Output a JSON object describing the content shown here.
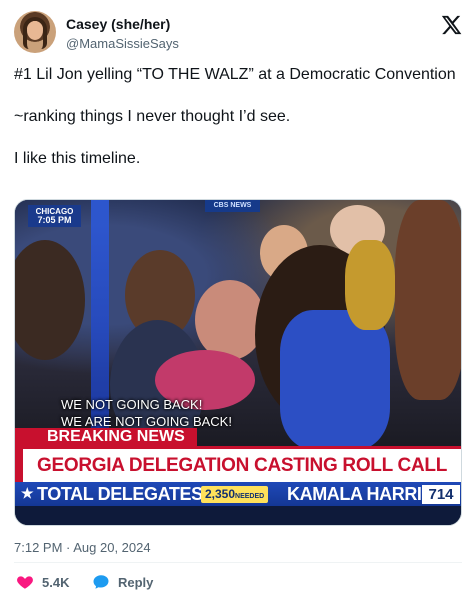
{
  "author": {
    "name": "Casey (she/her)",
    "handle": "@MamaSissieSays"
  },
  "icons": {
    "logo": "x-logo-icon",
    "like": "heart-icon",
    "reply": "speech-bubble-icon"
  },
  "tweet": {
    "paragraphs": [
      "#1 Lil Jon yelling “TO THE WALZ” at a Democratic Convention",
      "~ranking things I never thought I’d see.",
      "I like this timeline."
    ]
  },
  "media": {
    "city": "CHICAGO",
    "clock": "7:05 PM",
    "network_bug": "CBS NEWS",
    "caption_line1": "WE NOT GOING BACK!",
    "caption_line2": "WE ARE NOT GOING BACK!",
    "breaking": "BREAKING NEWS",
    "headline": "GEORGIA DELEGATION CASTING ROLL CALL VOTE",
    "ticker_label": "TOTAL DELEGATES",
    "needed_value": "2,350",
    "needed_suffix": "NEEDED",
    "candidate": "KAMALA HARRIS",
    "candidate_votes": "714"
  },
  "meta": {
    "timestamp": "7:12 PM · Aug 20, 2024",
    "likes": "5.4K",
    "reply_label": "Reply"
  },
  "colors": {
    "like": "#f91880",
    "reply": "#1d9bf0",
    "breaking_red": "#c8102e",
    "ticker_blue": "#1f49b8"
  }
}
